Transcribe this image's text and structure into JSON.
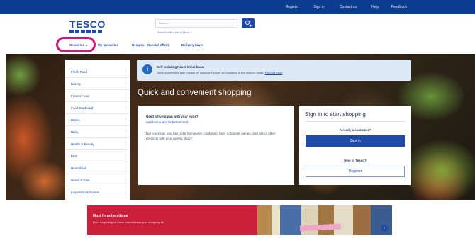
{
  "utility_bar": {
    "links": [
      "Register",
      "Sign in",
      "Contact us",
      "Help",
      "Feedback"
    ]
  },
  "header": {
    "logo": "TESCO",
    "search_label": "Search",
    "search_placeholder": "Search",
    "search_help": "Search with a list of items  >"
  },
  "main_nav": {
    "items": [
      "Groceries",
      "My favourites",
      "Recipes",
      "Special Offers",
      "Delivery Saver"
    ]
  },
  "side_nav": {
    "items": [
      "Fresh Food",
      "Bakery",
      "Frozen Food",
      "Food Cupboard",
      "Drinks",
      "Baby",
      "Health & Beauty",
      "Pets",
      "Household",
      "Home & Ents",
      "Inspiration & Events"
    ]
  },
  "notice": {
    "title": "Self-isolating? Just let us know",
    "text": "To keep everyone safe, please let us know if you're self-isolating in the delivery notes.",
    "link": "Find out more"
  },
  "hero": {
    "headline": "Quick and convenient shopping"
  },
  "info_card": {
    "title": "Need a frying pan with your eggs?",
    "link": "See Home and Entertainment",
    "body": "Did you know, you can order homeware, cookware, toys, computer games, and lots of other products with your weekly shop?"
  },
  "signin_card": {
    "title": "Sign in to start shopping",
    "already_label": "Already a customer?",
    "signin_button": "Sign in",
    "new_label": "New to Tesco?",
    "register_button": "Register"
  },
  "promo": {
    "title": "Most forgotten items",
    "subtitle": "Don't forget to pick these essentials as your shopping list"
  },
  "colors": {
    "brand_blue": "#1f4aa8",
    "util_bar": "#0a3d8f",
    "highlight_ring": "#d7137c",
    "promo_red": "#cc1f3c"
  }
}
